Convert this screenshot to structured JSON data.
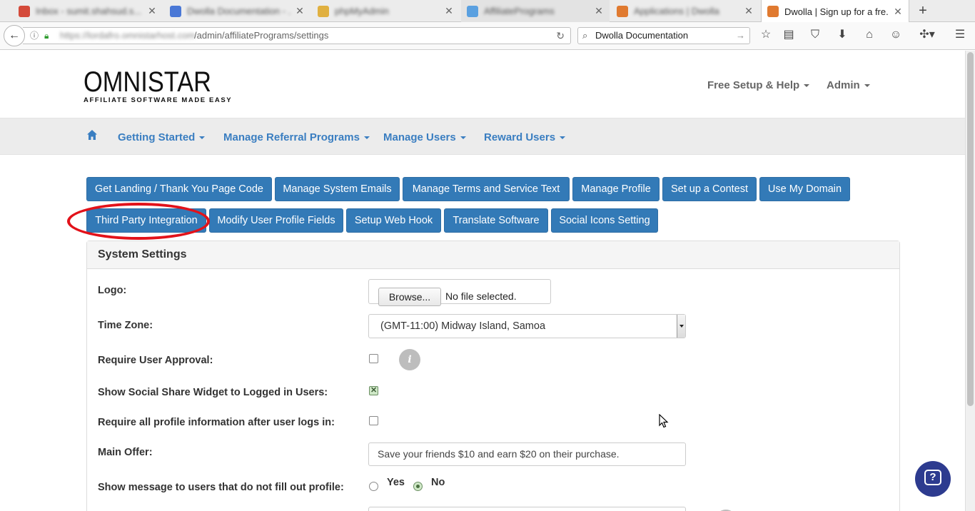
{
  "browser": {
    "tabs": [
      {
        "title": "Inbox - sumit.shahsud.s...",
        "favicon_color": "#d44a3a"
      },
      {
        "title": "Dwolla Documentation - ...",
        "favicon_color": "#4a78d6"
      },
      {
        "title": "phpMyAdmin",
        "favicon_color": "#e0b040"
      },
      {
        "title": "AffiliatePrograms",
        "favicon_color": "#5aa0e0"
      },
      {
        "title": "Applications | Dwolla",
        "favicon_color": "#e07a30"
      },
      {
        "title": "Dwolla | Sign up for a fre...",
        "favicon_color": "#e07a30"
      }
    ],
    "url_host": "https://lordafro.omnistarhost.com",
    "url_path": "/admin/affiliatePrograms/settings",
    "search_text": "Dwolla Documentation"
  },
  "site": {
    "logo_word": "OMNISTAR",
    "logo_tagline": "AFFILIATE SOFTWARE MADE EASY",
    "top_nav": {
      "help": "Free Setup & Help",
      "admin": "Admin"
    },
    "menu": {
      "getting_started": "Getting Started",
      "manage_referral": "Manage Referral Programs",
      "manage_users": "Manage Users",
      "reward_users": "Reward Users"
    },
    "buttons_row1": {
      "landing": "Get Landing / Thank You Page Code",
      "emails": "Manage System Emails",
      "terms": "Manage Terms and Service Text",
      "profile": "Manage Profile",
      "contest": "Set up a Contest",
      "domain": "Use My Domain"
    },
    "buttons_row2": {
      "third_party": "Third Party Integration",
      "modify_fields": "Modify User Profile Fields",
      "webhook": "Setup Web Hook",
      "translate": "Translate Software",
      "social_icons": "Social Icons Setting"
    },
    "panel": {
      "title": "System Settings",
      "logo_label": "Logo:",
      "browse_label": "Browse...",
      "no_file": "No file selected.",
      "timezone_label": "Time Zone:",
      "timezone_value": "(GMT-11:00) Midway Island, Samoa",
      "require_approval_label": "Require User Approval:",
      "require_approval_checked": false,
      "social_widget_label": "Show Social Share Widget to Logged in Users:",
      "social_widget_checked": true,
      "require_profile_label": "Require all profile information after user logs in:",
      "require_profile_checked": false,
      "main_offer_label": "Main Offer:",
      "main_offer_value": "Save your friends $10 and earn $20 on their purchase.",
      "show_message_label": "Show message to users that do not fill out profile:",
      "yes_label": "Yes",
      "no_label": "No",
      "show_message_selected": "No"
    }
  },
  "colors": {
    "primary_button": "#337ab7",
    "menu_link": "#3a7ec1",
    "highlight_ring": "#e2121a",
    "help_bubble": "#2d3b8f"
  }
}
